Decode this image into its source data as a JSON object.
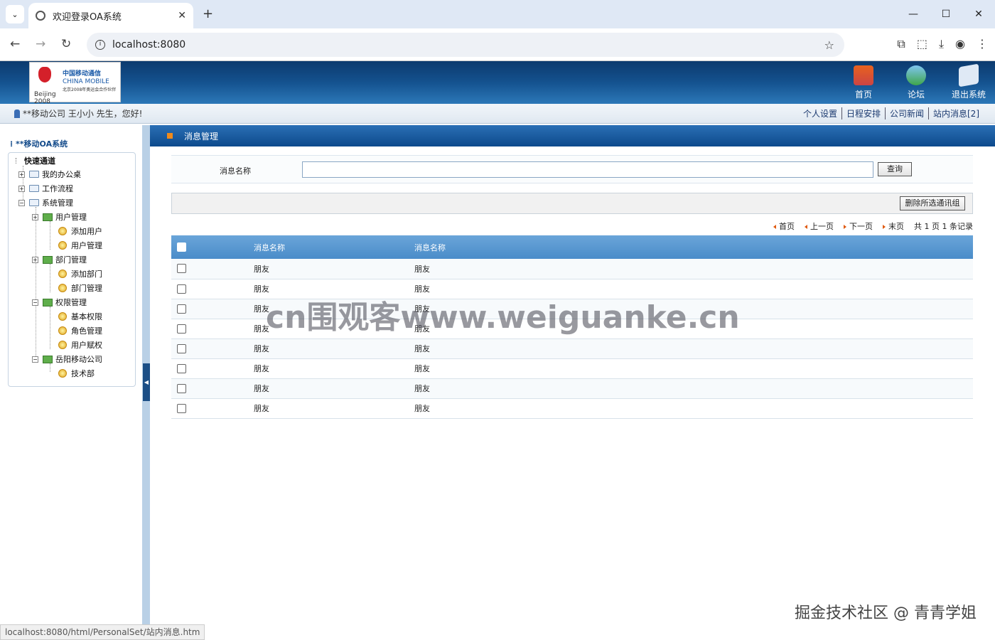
{
  "browser": {
    "tab_title": "欢迎登录OA系统",
    "url": "localhost:8080",
    "new_tab": "+",
    "close_tab": "✕",
    "window_controls": [
      "—",
      "☐",
      "✕"
    ]
  },
  "header": {
    "logo_brand": "中国移动通信",
    "logo_brand_en": "CHINA MOBILE",
    "logo_olympic": "Beijing 2008",
    "logo_caption": "北京2008年奥运会合作伙伴",
    "nav": [
      {
        "label": "首页",
        "icon": "home-icon"
      },
      {
        "label": "论坛",
        "icon": "forum-icon"
      },
      {
        "label": "退出系统",
        "icon": "exit-icon"
      }
    ]
  },
  "userbar": {
    "greeting": "**移动公司 王小小 先生，您好!",
    "links": [
      "个人设置",
      "日程安排",
      "公司新闻",
      "站内消息[2]"
    ]
  },
  "sidebar": {
    "title": "**移动OA系统",
    "tree": [
      {
        "label": "快速通道",
        "level": 0
      },
      {
        "label": "我的办公桌",
        "level": 1
      },
      {
        "label": "工作流程",
        "level": 1
      },
      {
        "label": "系统管理",
        "level": 1
      },
      {
        "label": "用户管理",
        "level": 2
      },
      {
        "label": "添加用户",
        "level": 3
      },
      {
        "label": "用户管理",
        "level": 3
      },
      {
        "label": "部门管理",
        "level": 2
      },
      {
        "label": "添加部门",
        "level": 3
      },
      {
        "label": "部门管理",
        "level": 3
      },
      {
        "label": "权限管理",
        "level": 2
      },
      {
        "label": "基本权限",
        "level": 3
      },
      {
        "label": "角色管理",
        "level": 3
      },
      {
        "label": "用户赋权",
        "level": 3
      },
      {
        "label": "岳阳移动公司",
        "level": 2
      },
      {
        "label": "技术部",
        "level": 3
      }
    ]
  },
  "main": {
    "title": "消息管理",
    "search_label": "消息名称",
    "search_value": "",
    "search_button": "查询",
    "delete_button": "删除所选通讯组",
    "pager": {
      "first": "首页",
      "prev": "上一页",
      "next": "下一页",
      "last": "末页",
      "summary": "共 1 页 1 条记录"
    },
    "columns": [
      "消息名称",
      "消息名称"
    ],
    "rows": [
      [
        "朋友",
        "朋友"
      ],
      [
        "朋友",
        "朋友"
      ],
      [
        "朋友",
        "朋友"
      ],
      [
        "朋友",
        "朋友"
      ],
      [
        "朋友",
        "朋友"
      ],
      [
        "朋友",
        "朋友"
      ],
      [
        "朋友",
        "朋友"
      ],
      [
        "朋友",
        "朋友"
      ]
    ]
  },
  "status_url": "localhost:8080/html/PersonalSet/站内消息.htm",
  "watermark": "cn围观客www.weiguanke.cn",
  "corner_credit": "掘金技术社区 @ 青青学姐",
  "colors": {
    "header_blue": "#14528f",
    "table_header": "#4a8cc9",
    "accent_orange": "#f08a1a"
  }
}
